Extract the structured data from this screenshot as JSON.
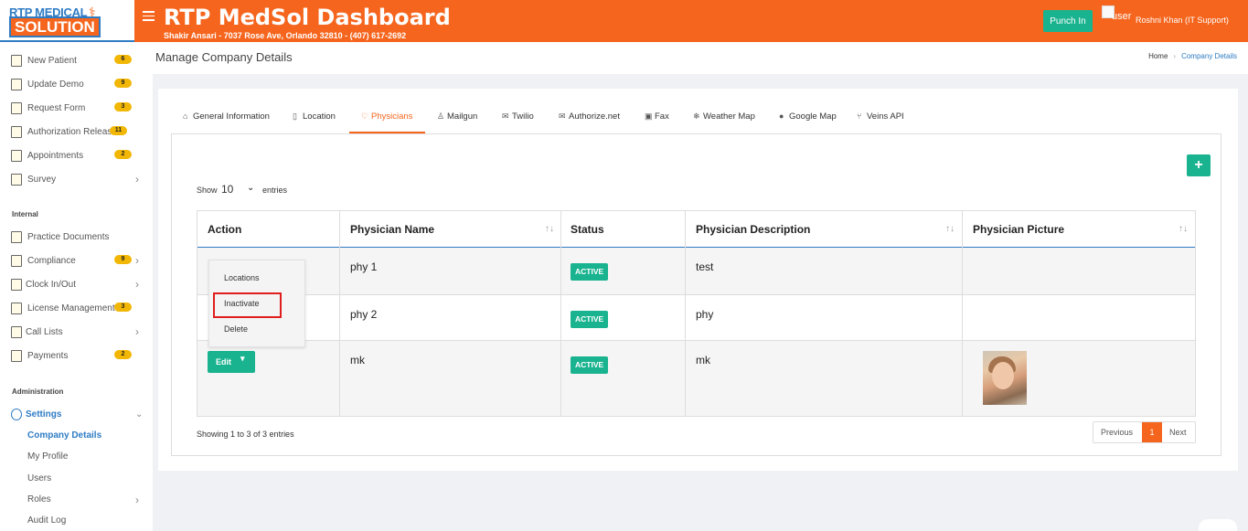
{
  "header": {
    "logo_line1": "RTP MEDICAL",
    "logo_line2": "SOLUTION",
    "title": "RTP MedSol Dashboard",
    "subtitle": "Shakir Ansari - 7037 Rose Ave, Orlando 32810 - (407) 617-2692",
    "punch_label": "Punch In",
    "user_alt": "user",
    "user_name": "Roshni Khan (IT Support)"
  },
  "sidebar": {
    "items": [
      {
        "label": "New Patient",
        "badge": "6",
        "icon": "clipboard-icon"
      },
      {
        "label": "Update Demo",
        "badge": "9",
        "icon": "id-card-icon"
      },
      {
        "label": "Request Form",
        "badge": "3",
        "icon": "form-icon"
      },
      {
        "label": "Authorization Release",
        "badge": "11",
        "icon": "auth-icon"
      },
      {
        "label": "Appointments",
        "badge": "2",
        "icon": "calendar-icon"
      },
      {
        "label": "Survey",
        "badge": "",
        "icon": "survey-icon"
      }
    ],
    "section_internal": "Internal",
    "internal_items": [
      {
        "label": "Practice Documents",
        "badge": "",
        "icon": "document-icon"
      },
      {
        "label": "Compliance",
        "badge": "9",
        "icon": "compliance-icon"
      },
      {
        "label": "Clock In/Out",
        "badge": "",
        "icon": "clock-icon"
      },
      {
        "label": "License Management",
        "badge": "3",
        "icon": "license-icon"
      },
      {
        "label": "Call Lists",
        "badge": "",
        "icon": "call-list-icon"
      },
      {
        "label": "Payments",
        "badge": "2",
        "icon": "payments-icon"
      }
    ],
    "section_admin": "Administration",
    "settings_label": "Settings",
    "settings_sub": [
      "Company Details",
      "My Profile",
      "Users",
      "Roles",
      "Audit Log"
    ]
  },
  "page": {
    "title": "Manage Company Details",
    "breadcrumb_home": "Home",
    "breadcrumb_current": "Company Details"
  },
  "tabs": [
    {
      "label": "General Information",
      "icon": "home-icon"
    },
    {
      "label": "Location",
      "icon": "map-icon"
    },
    {
      "label": "Physicians",
      "icon": "heart-icon"
    },
    {
      "label": "Mailgun",
      "icon": "user-icon"
    },
    {
      "label": "Twilio",
      "icon": "envelope-icon"
    },
    {
      "label": "Authorize.net",
      "icon": "envelope-icon"
    },
    {
      "label": "Fax",
      "icon": "fax-icon"
    },
    {
      "label": "Weather Map",
      "icon": "snowflake-icon"
    },
    {
      "label": "Google Map",
      "icon": "pin-icon"
    },
    {
      "label": "Veins API",
      "icon": "branch-icon"
    }
  ],
  "table": {
    "show_label": "Show",
    "page_size": "10",
    "entries_label": "entries",
    "columns": [
      "Action",
      "Physician Name",
      "Status",
      "Physician Description",
      "Physician Picture"
    ],
    "rows": [
      {
        "name": "phy 1",
        "status": "ACTIVE",
        "description": "test"
      },
      {
        "name": "phy 2",
        "status": "ACTIVE",
        "description": "phy"
      },
      {
        "name": "mk",
        "status": "ACTIVE",
        "description": "mk"
      }
    ],
    "edit_label": "Edit",
    "dropdown": [
      "Locations",
      "Inactivate",
      "Delete"
    ],
    "showing": "Showing 1 to 3 of 3 entries",
    "pager": {
      "prev": "Previous",
      "current": "1",
      "next": "Next"
    }
  },
  "colors": {
    "brand": "#f5651d",
    "accent": "#1ab38f",
    "link": "#2f7cc4",
    "badge": "#f2b705"
  }
}
